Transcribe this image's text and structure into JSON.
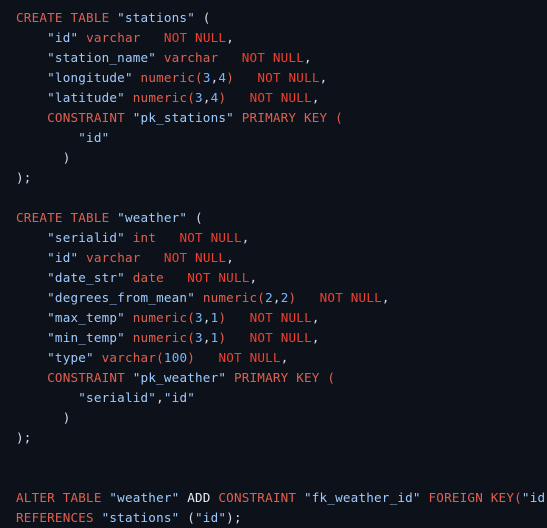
{
  "editor": {
    "language": "sql",
    "background_color": "#0d111a",
    "theme_colors": {
      "keyword": "#e0604f",
      "keyword_strong": "#f0402e",
      "type": "#e0604f",
      "string": "#9ecbff",
      "number": "#79b8ff",
      "punctuation": "#d8dee9",
      "plain": "#e6edf3"
    }
  },
  "code": {
    "lines": [
      {
        "indent": 0,
        "tokens": [
          {
            "t": "CREATE TABLE ",
            "c": "t-kw"
          },
          {
            "t": "\"stations\"",
            "c": "t-str"
          },
          {
            "t": " (",
            "c": "t-punct"
          }
        ]
      },
      {
        "indent": 4,
        "tokens": [
          {
            "t": "\"id\"",
            "c": "t-str"
          },
          {
            "t": " ",
            "c": "t-punct"
          },
          {
            "t": "varchar",
            "c": "t-type"
          },
          {
            "t": "   ",
            "c": "t-punct"
          },
          {
            "t": "NOT NULL",
            "c": "t-kw-str"
          },
          {
            "t": ",",
            "c": "t-punct"
          }
        ]
      },
      {
        "indent": 4,
        "tokens": [
          {
            "t": "\"station_name\"",
            "c": "t-str"
          },
          {
            "t": " ",
            "c": "t-punct"
          },
          {
            "t": "varchar",
            "c": "t-type"
          },
          {
            "t": "   ",
            "c": "t-punct"
          },
          {
            "t": "NOT NULL",
            "c": "t-kw-str"
          },
          {
            "t": ",",
            "c": "t-punct"
          }
        ]
      },
      {
        "indent": 4,
        "tokens": [
          {
            "t": "\"longitude\"",
            "c": "t-str"
          },
          {
            "t": " ",
            "c": "t-punct"
          },
          {
            "t": "numeric",
            "c": "t-type"
          },
          {
            "t": "(",
            "c": "t-type"
          },
          {
            "t": "3",
            "c": "t-num"
          },
          {
            "t": ",",
            "c": "t-punct"
          },
          {
            "t": "4",
            "c": "t-num"
          },
          {
            "t": ")",
            "c": "t-type"
          },
          {
            "t": "   ",
            "c": "t-punct"
          },
          {
            "t": "NOT NULL",
            "c": "t-kw-str"
          },
          {
            "t": ",",
            "c": "t-punct"
          }
        ]
      },
      {
        "indent": 4,
        "tokens": [
          {
            "t": "\"latitude\"",
            "c": "t-str"
          },
          {
            "t": " ",
            "c": "t-punct"
          },
          {
            "t": "numeric",
            "c": "t-type"
          },
          {
            "t": "(",
            "c": "t-type"
          },
          {
            "t": "3",
            "c": "t-num"
          },
          {
            "t": ",",
            "c": "t-punct"
          },
          {
            "t": "4",
            "c": "t-num"
          },
          {
            "t": ")",
            "c": "t-type"
          },
          {
            "t": "   ",
            "c": "t-punct"
          },
          {
            "t": "NOT NULL",
            "c": "t-kw-str"
          },
          {
            "t": ",",
            "c": "t-punct"
          }
        ]
      },
      {
        "indent": 4,
        "tokens": [
          {
            "t": "CONSTRAINT ",
            "c": "t-kw"
          },
          {
            "t": "\"pk_stations\"",
            "c": "t-str"
          },
          {
            "t": " ",
            "c": "t-punct"
          },
          {
            "t": "PRIMARY KEY ",
            "c": "t-kw"
          },
          {
            "t": "(",
            "c": "t-kw"
          }
        ]
      },
      {
        "indent": 8,
        "tokens": [
          {
            "t": "\"id\"",
            "c": "t-str"
          }
        ]
      },
      {
        "indent": 6,
        "tokens": [
          {
            "t": ")",
            "c": "t-punct"
          }
        ]
      },
      {
        "indent": 0,
        "tokens": [
          {
            "t": ");",
            "c": "t-punct"
          }
        ]
      },
      {
        "indent": 0,
        "tokens": []
      },
      {
        "indent": 0,
        "tokens": [
          {
            "t": "CREATE TABLE ",
            "c": "t-kw"
          },
          {
            "t": "\"weather\"",
            "c": "t-str"
          },
          {
            "t": " (",
            "c": "t-punct"
          }
        ]
      },
      {
        "indent": 4,
        "tokens": [
          {
            "t": "\"serialid\"",
            "c": "t-str"
          },
          {
            "t": " ",
            "c": "t-punct"
          },
          {
            "t": "int",
            "c": "t-type"
          },
          {
            "t": "   ",
            "c": "t-punct"
          },
          {
            "t": "NOT NULL",
            "c": "t-kw-str"
          },
          {
            "t": ",",
            "c": "t-punct"
          }
        ]
      },
      {
        "indent": 4,
        "tokens": [
          {
            "t": "\"id\"",
            "c": "t-str"
          },
          {
            "t": " ",
            "c": "t-punct"
          },
          {
            "t": "varchar",
            "c": "t-type"
          },
          {
            "t": "   ",
            "c": "t-punct"
          },
          {
            "t": "NOT NULL",
            "c": "t-kw-str"
          },
          {
            "t": ",",
            "c": "t-punct"
          }
        ]
      },
      {
        "indent": 4,
        "tokens": [
          {
            "t": "\"date_str\"",
            "c": "t-str"
          },
          {
            "t": " ",
            "c": "t-punct"
          },
          {
            "t": "date",
            "c": "t-type"
          },
          {
            "t": "   ",
            "c": "t-punct"
          },
          {
            "t": "NOT NULL",
            "c": "t-kw-str"
          },
          {
            "t": ",",
            "c": "t-punct"
          }
        ]
      },
      {
        "indent": 4,
        "tokens": [
          {
            "t": "\"degrees_from_mean\"",
            "c": "t-str"
          },
          {
            "t": " ",
            "c": "t-punct"
          },
          {
            "t": "numeric",
            "c": "t-type"
          },
          {
            "t": "(",
            "c": "t-type"
          },
          {
            "t": "2",
            "c": "t-num"
          },
          {
            "t": ",",
            "c": "t-punct"
          },
          {
            "t": "2",
            "c": "t-num"
          },
          {
            "t": ")",
            "c": "t-type"
          },
          {
            "t": "   ",
            "c": "t-punct"
          },
          {
            "t": "NOT NULL",
            "c": "t-kw-str"
          },
          {
            "t": ",",
            "c": "t-punct"
          }
        ]
      },
      {
        "indent": 4,
        "tokens": [
          {
            "t": "\"max_temp\"",
            "c": "t-str"
          },
          {
            "t": " ",
            "c": "t-punct"
          },
          {
            "t": "numeric",
            "c": "t-type"
          },
          {
            "t": "(",
            "c": "t-type"
          },
          {
            "t": "3",
            "c": "t-num"
          },
          {
            "t": ",",
            "c": "t-punct"
          },
          {
            "t": "1",
            "c": "t-num"
          },
          {
            "t": ")",
            "c": "t-type"
          },
          {
            "t": "   ",
            "c": "t-punct"
          },
          {
            "t": "NOT NULL",
            "c": "t-kw-str"
          },
          {
            "t": ",",
            "c": "t-punct"
          }
        ]
      },
      {
        "indent": 4,
        "tokens": [
          {
            "t": "\"min_temp\"",
            "c": "t-str"
          },
          {
            "t": " ",
            "c": "t-punct"
          },
          {
            "t": "numeric",
            "c": "t-type"
          },
          {
            "t": "(",
            "c": "t-type"
          },
          {
            "t": "3",
            "c": "t-num"
          },
          {
            "t": ",",
            "c": "t-punct"
          },
          {
            "t": "1",
            "c": "t-num"
          },
          {
            "t": ")",
            "c": "t-type"
          },
          {
            "t": "   ",
            "c": "t-punct"
          },
          {
            "t": "NOT NULL",
            "c": "t-kw-str"
          },
          {
            "t": ",",
            "c": "t-punct"
          }
        ]
      },
      {
        "indent": 4,
        "tokens": [
          {
            "t": "\"type\"",
            "c": "t-str"
          },
          {
            "t": " ",
            "c": "t-punct"
          },
          {
            "t": "varchar",
            "c": "t-type"
          },
          {
            "t": "(",
            "c": "t-type"
          },
          {
            "t": "100",
            "c": "t-num"
          },
          {
            "t": ")",
            "c": "t-type"
          },
          {
            "t": "   ",
            "c": "t-punct"
          },
          {
            "t": "NOT NULL",
            "c": "t-kw-str"
          },
          {
            "t": ",",
            "c": "t-punct"
          }
        ]
      },
      {
        "indent": 4,
        "tokens": [
          {
            "t": "CONSTRAINT ",
            "c": "t-kw"
          },
          {
            "t": "\"pk_weather\"",
            "c": "t-str"
          },
          {
            "t": " ",
            "c": "t-punct"
          },
          {
            "t": "PRIMARY KEY ",
            "c": "t-kw"
          },
          {
            "t": "(",
            "c": "t-kw"
          }
        ]
      },
      {
        "indent": 8,
        "tokens": [
          {
            "t": "\"serialid\"",
            "c": "t-str"
          },
          {
            "t": ",",
            "c": "t-punct"
          },
          {
            "t": "\"id\"",
            "c": "t-str"
          }
        ]
      },
      {
        "indent": 6,
        "tokens": [
          {
            "t": ")",
            "c": "t-punct"
          }
        ]
      },
      {
        "indent": 0,
        "tokens": [
          {
            "t": ");",
            "c": "t-punct"
          }
        ]
      },
      {
        "indent": 0,
        "tokens": []
      },
      {
        "indent": 0,
        "tokens": []
      },
      {
        "indent": 0,
        "tokens": [
          {
            "t": "ALTER TABLE ",
            "c": "t-kw"
          },
          {
            "t": "\"weather\"",
            "c": "t-str"
          },
          {
            "t": " ",
            "c": "t-punct"
          },
          {
            "t": "ADD ",
            "c": "t-plain"
          },
          {
            "t": "CONSTRAINT ",
            "c": "t-kw"
          },
          {
            "t": "\"fk_weather_id\"",
            "c": "t-str"
          },
          {
            "t": " ",
            "c": "t-punct"
          },
          {
            "t": "FOREIGN KEY",
            "c": "t-kw"
          },
          {
            "t": "(",
            "c": "t-kw"
          },
          {
            "t": "\"id\"",
            "c": "t-str"
          },
          {
            "t": ")",
            "c": "t-kw"
          }
        ]
      },
      {
        "indent": 0,
        "tokens": [
          {
            "t": "REFERENCES ",
            "c": "t-kw"
          },
          {
            "t": "\"stations\"",
            "c": "t-str"
          },
          {
            "t": " (",
            "c": "t-punct"
          },
          {
            "t": "\"id\"",
            "c": "t-str"
          },
          {
            "t": ");",
            "c": "t-punct"
          }
        ]
      }
    ],
    "plain_text": "CREATE TABLE \"stations\" (\n    \"id\" varchar   NOT NULL,\n    \"station_name\" varchar   NOT NULL,\n    \"longitude\" numeric(3,4)   NOT NULL,\n    \"latitude\" numeric(3,4)   NOT NULL,\n    CONSTRAINT \"pk_stations\" PRIMARY KEY (\n        \"id\"\n     )\n);\n\nCREATE TABLE \"weather\" (\n    \"serialid\" int   NOT NULL,\n    \"id\" varchar   NOT NULL,\n    \"date_str\" date   NOT NULL,\n    \"degrees_from_mean\" numeric(2,2)   NOT NULL,\n    \"max_temp\" numeric(3,1)   NOT NULL,\n    \"min_temp\" numeric(3,1)   NOT NULL,\n    \"type\" varchar(100)   NOT NULL,\n    CONSTRAINT \"pk_weather\" PRIMARY KEY (\n        \"serialid\",\"id\"\n     )\n);\n\n\nALTER TABLE \"weather\" ADD CONSTRAINT \"fk_weather_id\" FOREIGN KEY(\"id\")\nREFERENCES \"stations\" (\"id\");"
  }
}
